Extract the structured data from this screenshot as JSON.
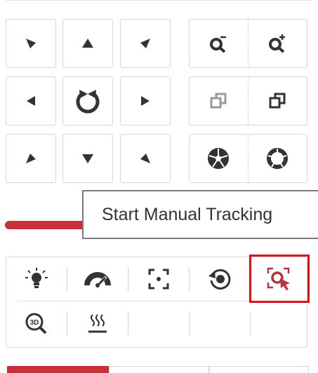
{
  "tooltip": {
    "text": "Start Manual Tracking"
  },
  "ptz_icons": {
    "up_left": "arrow-up-left-icon",
    "up": "arrow-up-icon",
    "up_right": "arrow-up-right-icon",
    "left": "arrow-left-icon",
    "auto_scan": "auto-scan-icon",
    "right": "arrow-right-icon",
    "down_left": "arrow-down-left-icon",
    "down": "arrow-down-icon",
    "down_right": "arrow-down-right-icon",
    "zoom_out": "zoom-out-icon",
    "zoom_in": "zoom-in-icon",
    "focus_near": "focus-near-icon",
    "focus_far": "focus-far-icon",
    "iris_close": "iris-close-icon",
    "iris_open": "iris-open-icon"
  },
  "function_icons": [
    "light-icon",
    "wiper-icon",
    "lens-init-icon",
    "one-touch-park-icon",
    "manual-tracking-icon",
    "3d-zoom-icon",
    "heater-icon"
  ],
  "colors": {
    "accent": "#c8303a",
    "highlight": "#e0101a",
    "icon": "#333333"
  }
}
